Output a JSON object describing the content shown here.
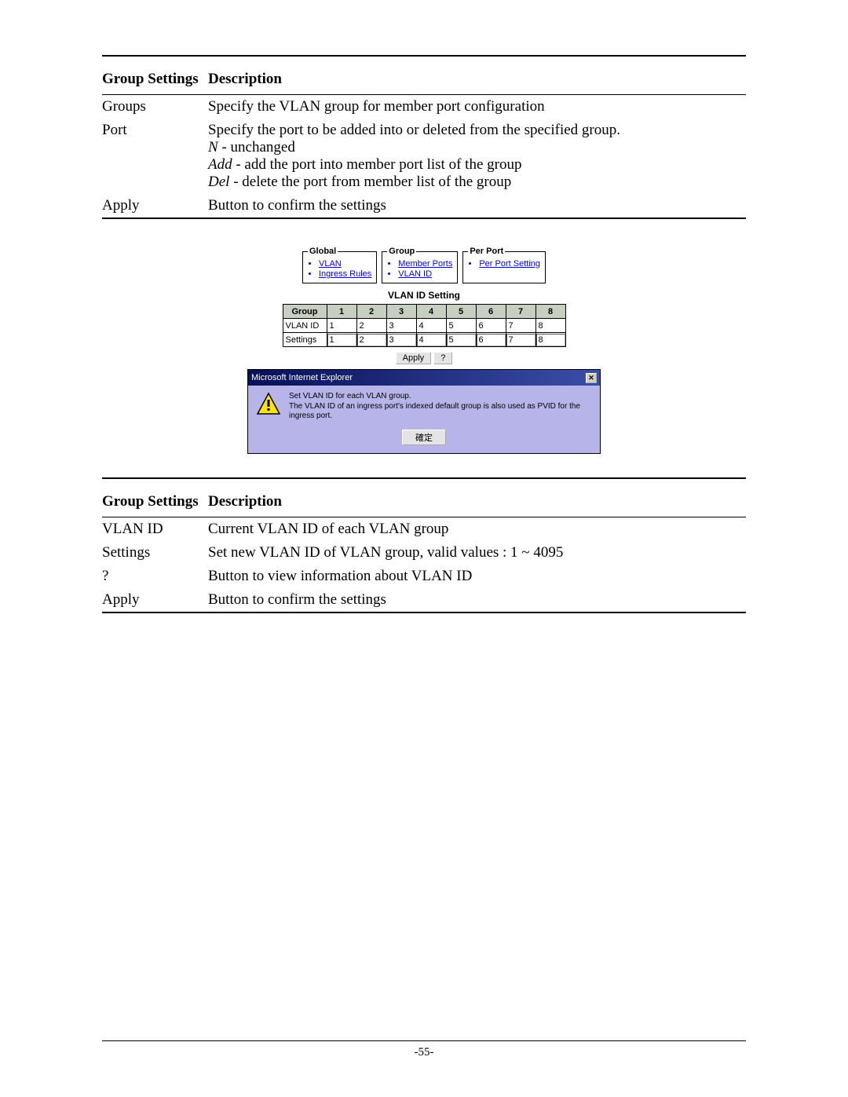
{
  "page_number": "-55-",
  "table1": {
    "header_left": "Group Settings",
    "header_right": "Description",
    "rows": [
      {
        "label": "Groups",
        "desc": "Specify the VLAN group for member port configuration"
      },
      {
        "label": "Port",
        "desc_line1": "Specify the port to be added into or deleted from the specified group.",
        "n_italic": "N",
        "n_rest": " - unchanged",
        "add_italic": "Add",
        "add_rest": " - add the port into member port list of the group",
        "del_italic": "Del",
        "del_rest": " - delete the port from member list of the group"
      },
      {
        "label": "Apply",
        "desc": "Button to confirm the settings"
      }
    ]
  },
  "table2": {
    "header_left": "Group Settings",
    "header_right": "Description",
    "rows": [
      {
        "label": "VLAN ID",
        "desc": "Current VLAN ID of each VLAN group"
      },
      {
        "label": "Settings",
        "desc": "Set new VLAN ID of VLAN group, valid values : 1 ~ 4095"
      },
      {
        "label": "?",
        "desc": "Button to view information about VLAN ID"
      },
      {
        "label": "Apply",
        "desc": "Button to confirm the settings"
      }
    ]
  },
  "screenshot": {
    "nav_global_legend": "Global",
    "nav_global_items": [
      "VLAN",
      "Ingress Rules"
    ],
    "nav_group_legend": "Group",
    "nav_group_items": [
      "Member Ports",
      "VLAN ID"
    ],
    "nav_perport_legend": "Per Port",
    "nav_perport_items": [
      "Per Port Setting"
    ],
    "section_title": "VLAN ID Setting",
    "col_group": "Group",
    "cols": [
      "1",
      "2",
      "3",
      "4",
      "5",
      "6",
      "7",
      "8"
    ],
    "row_vlanid_label": "VLAN ID",
    "row_vlanid_vals": [
      "1",
      "2",
      "3",
      "4",
      "5",
      "6",
      "7",
      "8"
    ],
    "row_settings_label": "Settings",
    "row_settings_vals": [
      "1",
      "2",
      "3",
      "4",
      "5",
      "6",
      "7",
      "8"
    ],
    "apply_label": "Apply",
    "help_label": "?",
    "msgbox_title": "Microsoft Internet Explorer",
    "msgbox_line1": "Set VLAN ID for each VLAN group.",
    "msgbox_line2": "The VLAN ID of an ingress port's indexed default group is also used as PVID for the ingress port.",
    "msgbox_ok": "確定"
  },
  "chart_data": {
    "type": "table",
    "title": "VLAN ID Setting",
    "columns": [
      "Group",
      "1",
      "2",
      "3",
      "4",
      "5",
      "6",
      "7",
      "8"
    ],
    "rows": [
      {
        "label": "VLAN ID",
        "values": [
          1,
          2,
          3,
          4,
          5,
          6,
          7,
          8
        ]
      },
      {
        "label": "Settings",
        "values": [
          1,
          2,
          3,
          4,
          5,
          6,
          7,
          8
        ]
      }
    ]
  }
}
